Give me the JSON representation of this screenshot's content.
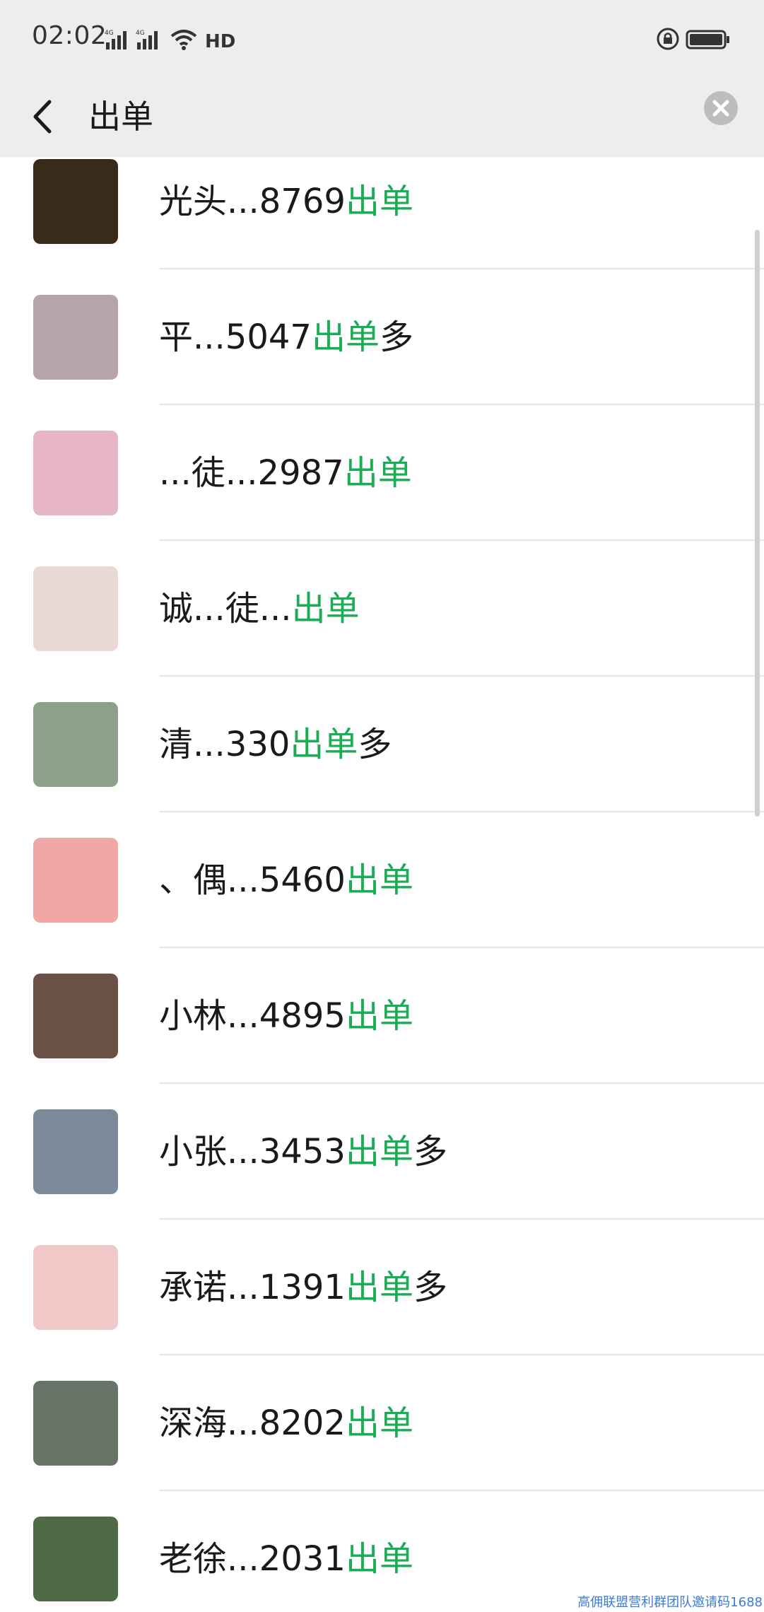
{
  "status_bar": {
    "time": "02:02",
    "network1": "4G",
    "network2": "4G",
    "hd_label": "HD"
  },
  "header": {
    "title": "出单"
  },
  "results": [
    {
      "prefix": "光头...8769",
      "keyword": "出单",
      "suffix": "",
      "avatar_color": "#3a2a1a"
    },
    {
      "prefix": "平...5047",
      "keyword": "出单",
      "suffix": "多",
      "avatar_color": "#b7a4a8"
    },
    {
      "prefix": "...徒...2987",
      "keyword": "出单",
      "suffix": "",
      "avatar_color": "#e7b6c4"
    },
    {
      "prefix": "诚...徒...",
      "keyword": "出单",
      "suffix": "",
      "avatar_color": "#e9d8d4"
    },
    {
      "prefix": "清...330",
      "keyword": "出单",
      "suffix": "多",
      "avatar_color": "#8da08a"
    },
    {
      "prefix": "、偶...5460",
      "keyword": "出单",
      "suffix": "",
      "avatar_color": "#f2a7a7"
    },
    {
      "prefix": "小林...4895",
      "keyword": "出单",
      "suffix": "",
      "avatar_color": "#6b5045"
    },
    {
      "prefix": "小张...3453",
      "keyword": "出单",
      "suffix": "多",
      "avatar_color": "#7a8a98"
    },
    {
      "prefix": "承诺...1391",
      "keyword": "出单",
      "suffix": "多",
      "avatar_color": "#f0c8c8"
    },
    {
      "prefix": "深海...8202",
      "keyword": "出单",
      "suffix": "",
      "avatar_color": "#687468"
    },
    {
      "prefix": "老徐...2031",
      "keyword": "出单",
      "suffix": "",
      "avatar_color": "#4f6b45"
    }
  ],
  "watermark": "高佣联盟营利群团队邀请码1688"
}
